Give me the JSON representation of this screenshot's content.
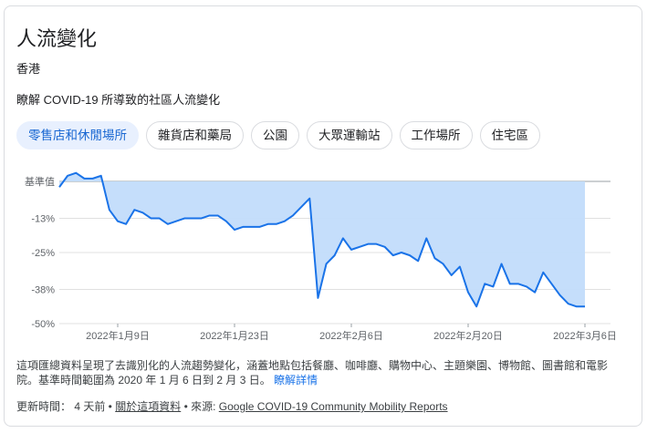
{
  "card": {
    "title": "人流變化",
    "region": "香港",
    "subtitle": "瞭解 COVID-19 所導致的社區人流變化"
  },
  "tabs": [
    {
      "label": "零售店和休閒場所",
      "active": true
    },
    {
      "label": "雜貨店和藥局",
      "active": false
    },
    {
      "label": "公園",
      "active": false
    },
    {
      "label": "大眾運輸站",
      "active": false
    },
    {
      "label": "工作場所",
      "active": false
    },
    {
      "label": "住宅區",
      "active": false
    }
  ],
  "chart_data": {
    "type": "area",
    "title": "",
    "xlabel": "",
    "ylabel": "",
    "y_tick_labels": [
      "基準值",
      "-13%",
      "-25%",
      "-38%",
      "-50%"
    ],
    "y_ticks": [
      0,
      -13,
      -25,
      -38,
      -50
    ],
    "ylim": [
      -50,
      0
    ],
    "x_tick_labels": [
      "2022年1月9日",
      "2022年1月23日",
      "2022年2月6日",
      "2022年2月20日",
      "2022年3月6日"
    ],
    "x_tick_indices": [
      7,
      21,
      35,
      49,
      63
    ],
    "grid": true,
    "colors": {
      "line": "#1a73e8",
      "fill": "#c2dcfb",
      "grid": "#e0e0e0",
      "baseline": "#9aa0a6"
    },
    "series": [
      {
        "values": [
          -2,
          2,
          3,
          1,
          1,
          2,
          -10,
          -14,
          -15,
          -10,
          -11,
          -13,
          -13,
          -15,
          -14,
          -13,
          -13,
          -13,
          -12,
          -12,
          -14,
          -17,
          -16,
          -16,
          -16,
          -15,
          -15,
          -14,
          -12,
          -9,
          -6,
          -41,
          -29,
          -26,
          -20,
          -24,
          -23,
          -22,
          -22,
          -23,
          -26,
          -25,
          -26,
          -28,
          -20,
          -27,
          -29,
          -33,
          -30,
          -39,
          -44,
          -36,
          -37,
          -29,
          -36,
          -36,
          -37,
          -39,
          -32,
          -36,
          -40,
          -43,
          -44,
          -44
        ]
      }
    ]
  },
  "footnote": {
    "text": "這項匯總資料呈現了去識別化的人流趨勢變化，涵蓋地點包括餐廳、咖啡廳、購物中心、主題樂園、博物館、圖書館和電影院。基準時間範圍為 2020 年 1 月 6 日到 2 月 3 日。",
    "link": "瞭解詳情"
  },
  "updated": {
    "prefix": "更新時間： 4 天前 • ",
    "about_link": "關於這項資料",
    "source_prefix": " • 來源: ",
    "source_link": "Google COVID-19 Community Mobility Reports"
  }
}
